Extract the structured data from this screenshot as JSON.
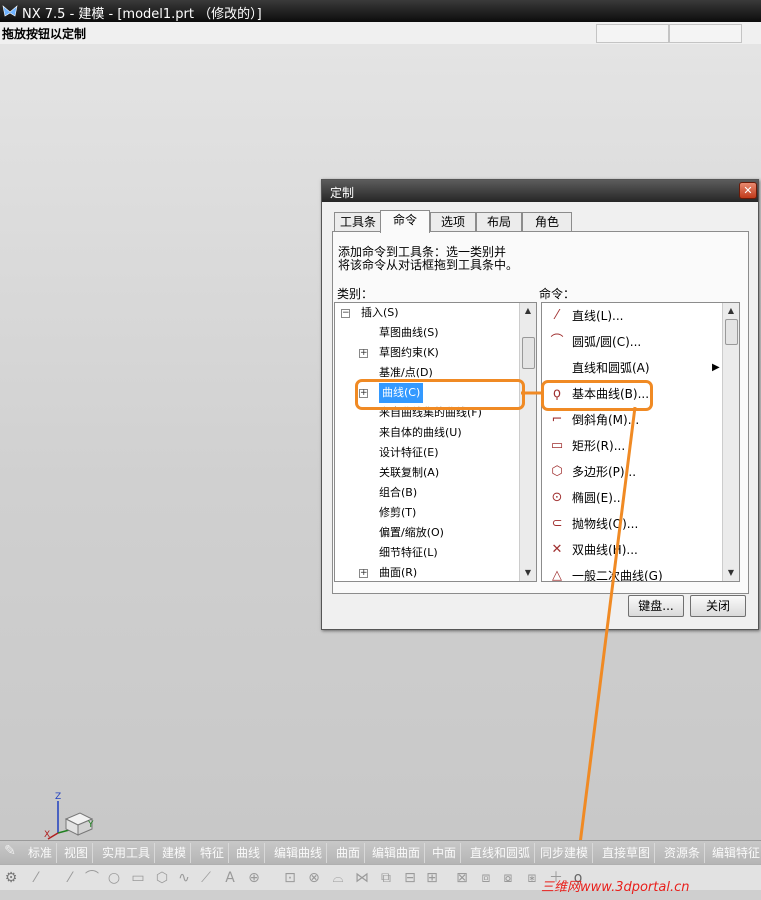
{
  "window": {
    "title": "NX 7.5 - 建模 - [model1.prt （修改的）]",
    "hint": "拖放按钮以定制"
  },
  "dialog": {
    "title": "定制",
    "close_label": "✕",
    "tabs": [
      "工具条",
      "命令",
      "选项",
      "布局",
      "角色"
    ],
    "active_tab": "命令",
    "instruction_line1": "添加命令到工具条：选一类别并",
    "instruction_line2": "将该命令从对话框拖到工具条中。",
    "category_label": "类别：",
    "command_label": "命令：",
    "categories": [
      {
        "label": "插入(S)",
        "expander": "minus"
      },
      {
        "label": "草图曲线(S)",
        "expander": ""
      },
      {
        "label": "草图约束(K)",
        "expander": "plus"
      },
      {
        "label": "基准/点(D)",
        "expander": ""
      },
      {
        "label": "曲线(C)",
        "expander": "plus",
        "selected": true
      },
      {
        "label": "来自曲线集的曲线(F)",
        "expander": ""
      },
      {
        "label": "来自体的曲线(U)",
        "expander": ""
      },
      {
        "label": "设计特征(E)",
        "expander": ""
      },
      {
        "label": "关联复制(A)",
        "expander": ""
      },
      {
        "label": "组合(B)",
        "expander": ""
      },
      {
        "label": "修剪(T)",
        "expander": ""
      },
      {
        "label": "偏置/缩放(O)",
        "expander": ""
      },
      {
        "label": "细节特征(L)",
        "expander": ""
      },
      {
        "label": "曲面(R)",
        "expander": "plus"
      }
    ],
    "commands": [
      {
        "label": "直线(L)...",
        "icon": "line-icon",
        "glyph": "⁄"
      },
      {
        "label": "圆弧/圆(C)...",
        "icon": "arc-icon",
        "glyph": "⌒"
      },
      {
        "label": "直线和圆弧(A)",
        "icon": "",
        "glyph": "",
        "submenu": true
      },
      {
        "label": "基本曲线(B)...",
        "icon": "basic-curve-icon",
        "glyph": "ϙ"
      },
      {
        "label": "倒斜角(M)...",
        "icon": "chamfer-icon",
        "glyph": "⌐"
      },
      {
        "label": "矩形(R)...",
        "icon": "rectangle-icon",
        "glyph": "▭"
      },
      {
        "label": "多边形(P)...",
        "icon": "polygon-icon",
        "glyph": "⬡"
      },
      {
        "label": "椭圆(E)...",
        "icon": "ellipse-icon",
        "glyph": "⊙"
      },
      {
        "label": "抛物线(O)...",
        "icon": "parabola-icon",
        "glyph": "⊂"
      },
      {
        "label": "双曲线(H)...",
        "icon": "hyperbola-icon",
        "glyph": "✕"
      },
      {
        "label": "一般二次曲线(G)",
        "icon": "conic-icon",
        "glyph": "△"
      }
    ],
    "keyboard_button": "键盘...",
    "close_button": "关闭"
  },
  "axes": {
    "x": "X",
    "y": "Y",
    "z": "Z"
  },
  "toolbar_tabs": [
    "标准",
    "视图",
    "实用工具",
    "建模",
    "特征",
    "曲线",
    "编辑曲线",
    "曲面",
    "编辑曲面",
    "中面",
    "直线和圆弧",
    "同步建模",
    "直接草图",
    "资源条",
    "编辑特征"
  ],
  "watermark": "三维网www.3dportal.cn",
  "colors": {
    "accent": "#f08a24",
    "selection": "#3399ff",
    "title_bar": "#1a1a1a"
  }
}
